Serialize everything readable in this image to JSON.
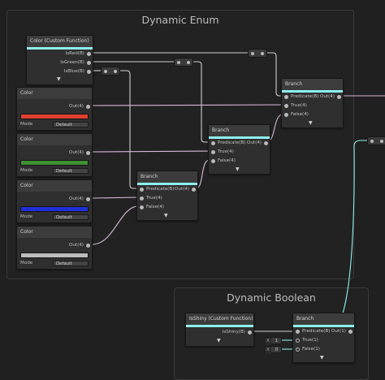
{
  "groups": {
    "enum": {
      "title": "Dynamic Enum"
    },
    "boolean": {
      "title": "Dynamic Boolean"
    }
  },
  "nodes": {
    "color_custom": {
      "title": "Color (Custom Function)",
      "outputs": [
        "IsRed(B)",
        "IsGreen(B)",
        "IsBlue(B)"
      ]
    },
    "color_red": {
      "title": "Color",
      "output": "Out(4)",
      "mode_label": "Mode",
      "mode_value": "Default",
      "swatch": "#e0402f"
    },
    "color_green": {
      "title": "Color",
      "output": "Out(4)",
      "mode_label": "Mode",
      "mode_value": "Default",
      "swatch": "#3f8f33"
    },
    "color_blue": {
      "title": "Color",
      "output": "Out(4)",
      "mode_label": "Mode",
      "mode_value": "Default",
      "swatch": "#1f2fd8"
    },
    "color_white": {
      "title": "Color",
      "output": "Out(4)",
      "mode_label": "Mode",
      "mode_value": "Default",
      "swatch": "#bdbdbd"
    },
    "branch_top": {
      "title": "Branch",
      "inputs": [
        "Predicate(B)",
        "True(4)",
        "False(4)"
      ],
      "output": "Out(4)"
    },
    "branch_mid": {
      "title": "Branch",
      "inputs": [
        "Predicate(B)",
        "True(4)",
        "False(4)"
      ],
      "output": "Out(4)"
    },
    "branch_low": {
      "title": "Branch",
      "inputs": [
        "Predicate(B)",
        "True(4)",
        "False(4)"
      ],
      "output": "Out(4)"
    },
    "isshiny": {
      "title": "IsShiny (Custom Function)",
      "output": "IsShiny(B)"
    },
    "branch_bool": {
      "title": "Branch",
      "inputs": [
        "Predicate(B)",
        "True(1)",
        "False(1)"
      ],
      "output": "Out(1)",
      "true_value": {
        "tag": "X",
        "value": "1"
      },
      "false_value": {
        "tag": "X",
        "value": "0"
      }
    }
  },
  "icons": {
    "expand": "chevron-down-icon"
  },
  "colors": {
    "accent": "#8ef0ee",
    "wire_vector": "#d9b8d9",
    "wire_bool": "#cfcfcf",
    "wire_float": "#8ef0ee"
  }
}
